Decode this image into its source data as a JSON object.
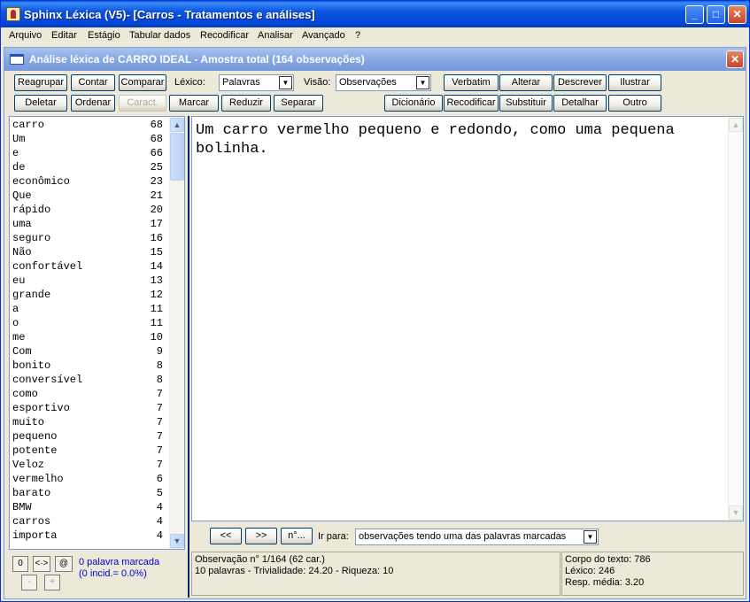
{
  "window": {
    "title": "Sphinx Léxica (V5)- [Carros - Tratamentos e análises]",
    "controls": {
      "minimize": "_",
      "maximize": "□",
      "close": "✕"
    }
  },
  "menu": [
    "Arquivo",
    "Editar",
    "Estágio",
    "Tabular dados",
    "Recodificar",
    "Analisar",
    "Avançado",
    "?"
  ],
  "inner": {
    "title": "Análise léxica de CARRO IDEAL - Amostra total (164 observações)",
    "close": "✕"
  },
  "toolbar": {
    "row1": [
      "Reagrupar",
      "Contar",
      "Comparar"
    ],
    "lexico_label": "Léxico:",
    "lexico_value": "Palavras",
    "visao_label": "Visão:",
    "visao_value": "Observações",
    "row1_right": [
      "Verbatim",
      "Alterar",
      "Descrever",
      "Ilustrar"
    ],
    "row2": [
      "Deletar",
      "Ordenar",
      "Caract.",
      "Marcar",
      "Reduzir",
      "Separar"
    ],
    "row2_right": [
      "Dicionário",
      "Recodificar",
      "Substituir",
      "Detalhar",
      "Outro"
    ]
  },
  "wordlist": [
    {
      "word": "carro",
      "count": "68"
    },
    {
      "word": "Um",
      "count": "68"
    },
    {
      "word": "e",
      "count": "66"
    },
    {
      "word": "de",
      "count": "25"
    },
    {
      "word": "econômico",
      "count": "23"
    },
    {
      "word": "Que",
      "count": "21"
    },
    {
      "word": "rápido",
      "count": "20"
    },
    {
      "word": "uma",
      "count": "17"
    },
    {
      "word": "seguro",
      "count": "16"
    },
    {
      "word": "Não",
      "count": "15"
    },
    {
      "word": "confortável",
      "count": "14"
    },
    {
      "word": "eu",
      "count": "13"
    },
    {
      "word": "grande",
      "count": "12"
    },
    {
      "word": "a",
      "count": "11"
    },
    {
      "word": "o",
      "count": "11"
    },
    {
      "word": "me",
      "count": "10"
    },
    {
      "word": "Com",
      "count": "9"
    },
    {
      "word": "bonito",
      "count": "8"
    },
    {
      "word": "conversível",
      "count": "8"
    },
    {
      "word": "como",
      "count": "7"
    },
    {
      "word": "esportivo",
      "count": "7"
    },
    {
      "word": "muito",
      "count": "7"
    },
    {
      "word": "pequeno",
      "count": "7"
    },
    {
      "word": "potente",
      "count": "7"
    },
    {
      "word": "Veloz",
      "count": "7"
    },
    {
      "word": "vermelho",
      "count": "6"
    },
    {
      "word": "barato",
      "count": "5"
    },
    {
      "word": "BMW",
      "count": "4"
    },
    {
      "word": "carros",
      "count": "4"
    },
    {
      "word": "importa",
      "count": "4"
    }
  ],
  "text": "Um carro vermelho pequeno e redondo, como uma pequena bolinha.",
  "nav": {
    "prev": "<<",
    "next": ">>",
    "num": "n°...",
    "goto_label": "Ir para:",
    "goto_value": "observações tendo uma das palavras marcadas"
  },
  "marks": {
    "btn0": "0",
    "btn1": "<·>",
    "btn2": "@",
    "minus": "-",
    "plus": "+",
    "line1": "0 palavra marcada",
    "line2": "(0 incid.= 0.0%)"
  },
  "status": {
    "obs_line1": "Observação n° 1/164 (62 car.)",
    "obs_line2": "10 palavras - Trivialidade: 24.20 - Riqueza: 10",
    "corpus_line1": "Corpo do texto: 786",
    "corpus_line2": "Léxico: 246",
    "corpus_line3": "Resp. média: 3.20"
  }
}
